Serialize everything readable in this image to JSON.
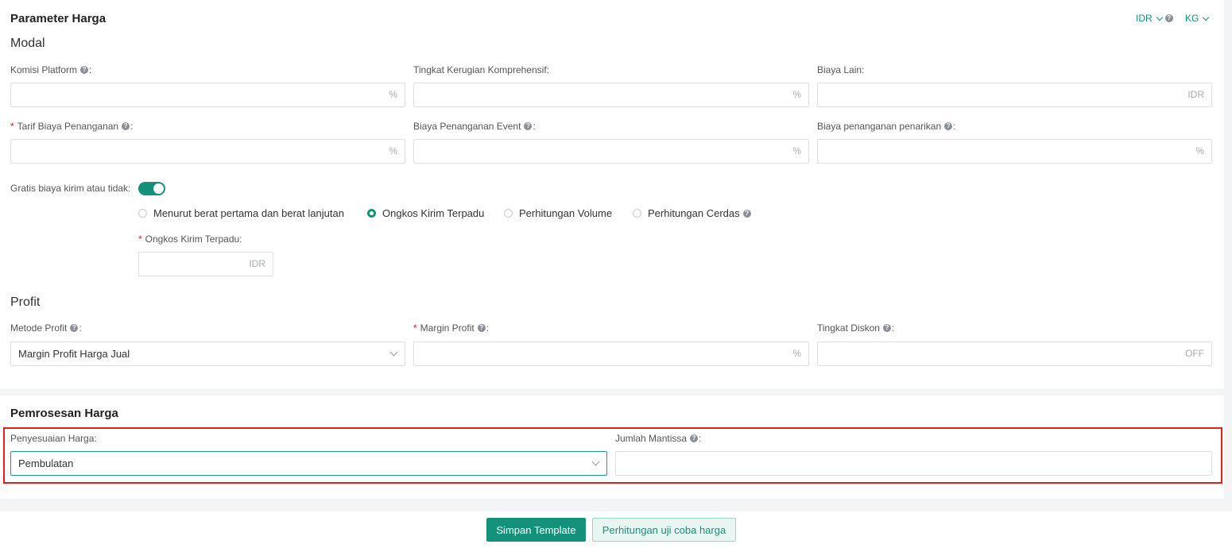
{
  "currency": "IDR",
  "weight_unit": "KG",
  "section_price_params": {
    "title": "Parameter Harga",
    "modal_title": "Modal",
    "platform_commission": {
      "label": "Komisi Platform",
      "suffix": "%"
    },
    "loss_rate": {
      "label": "Tingkat Kerugian Komprehensif:",
      "suffix": "%"
    },
    "other_cost": {
      "label": "Biaya Lain:",
      "suffix": "IDR"
    },
    "handling_fee_rate": {
      "label": "Tarif Biaya Penanganan",
      "suffix": "%"
    },
    "event_handling_fee": {
      "label": "Biaya Penanganan Event",
      "suffix": "%"
    },
    "withdrawal_fee": {
      "label": "Biaya penanganan penarikan",
      "suffix": "%"
    },
    "free_shipping": {
      "label": "Gratis biaya kirim atau tidak:",
      "enabled": true
    },
    "shipping_options": [
      {
        "label": "Menurut berat pertama dan berat lanjutan",
        "selected": false
      },
      {
        "label": "Ongkos Kirim Terpadu",
        "selected": true
      },
      {
        "label": "Perhitungan Volume",
        "selected": false
      },
      {
        "label": "Perhitungan Cerdas",
        "selected": false
      }
    ],
    "unified_shipping": {
      "label": "Ongkos Kirim Terpadu:",
      "suffix": "IDR"
    },
    "profit_title": "Profit",
    "profit_method": {
      "label": "Metode Profit",
      "value": "Margin Profit Harga Jual"
    },
    "profit_margin": {
      "label": "Margin Profit",
      "suffix": "%"
    },
    "discount_rate": {
      "label": "Tingkat Diskon",
      "suffix": "OFF"
    }
  },
  "section_price_processing": {
    "title": "Pemrosesan Harga",
    "price_adjustment": {
      "label": "Penyesuaian Harga:",
      "value": "Pembulatan"
    },
    "mantissa_count": {
      "label": "Jumlah Mantissa",
      "value": ""
    }
  },
  "footer": {
    "save_label": "Simpan Template",
    "trial_label": "Perhitungan uji coba harga"
  },
  "colors": {
    "accent": "#14917a",
    "highlight": "#e02020"
  }
}
